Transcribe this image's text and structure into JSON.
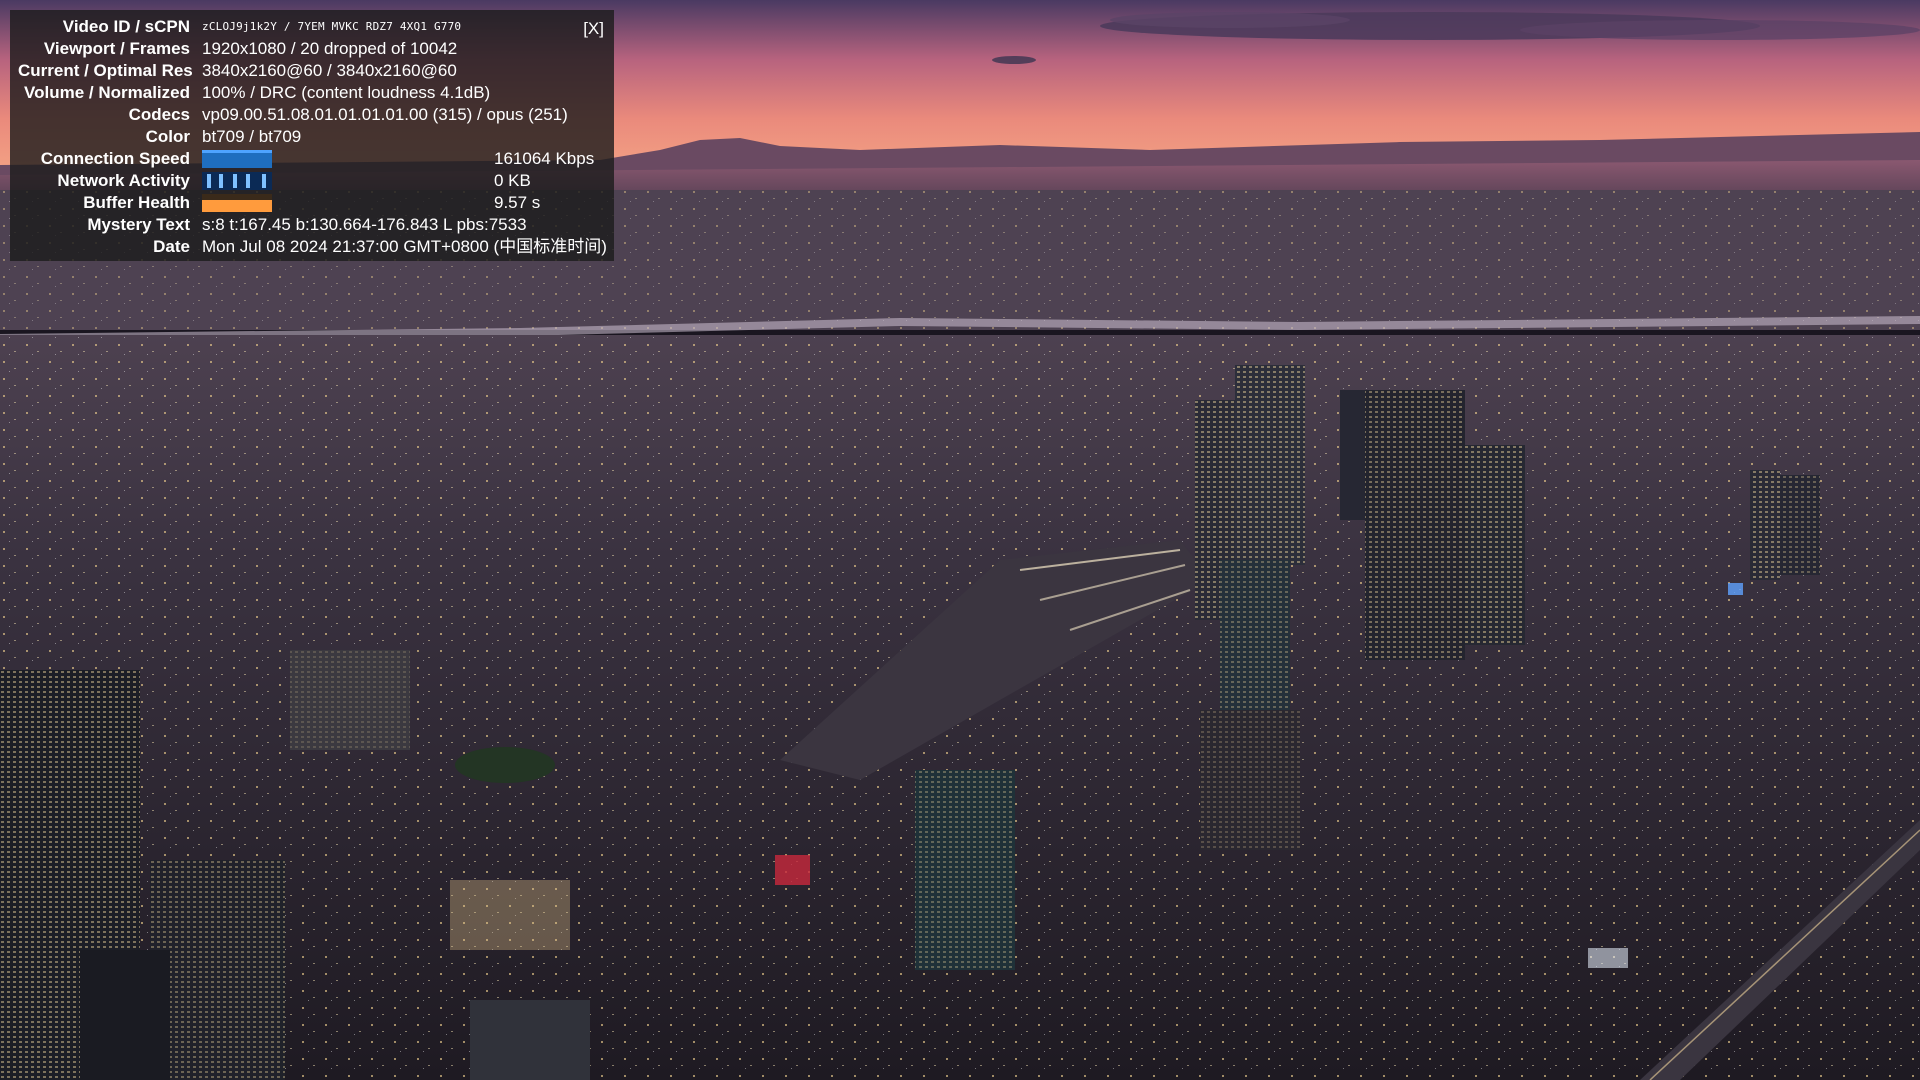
{
  "stats": {
    "close_label": "[X]",
    "rows": [
      {
        "label": "Video ID / sCPN",
        "value": "zCLOJ9j1k2Y / 7YEM MVKC RDZ7 4XQ1 G770"
      },
      {
        "label": "Viewport / Frames",
        "value": "1920x1080 / 20 dropped of 10042"
      },
      {
        "label": "Current / Optimal Res",
        "value": "3840x2160@60 / 3840x2160@60"
      },
      {
        "label": "Volume / Normalized",
        "value": "100% / DRC (content loudness 4.1dB)"
      },
      {
        "label": "Codecs",
        "value": "vp09.00.51.08.01.01.01.01.00 (315) / opus (251)"
      },
      {
        "label": "Color",
        "value": "bt709 / bt709"
      }
    ],
    "graphs": [
      {
        "label": "Connection Speed",
        "value": "161064 Kbps"
      },
      {
        "label": "Network Activity",
        "value": "0 KB"
      },
      {
        "label": "Buffer Health",
        "value": "9.57 s"
      }
    ],
    "tail_rows": [
      {
        "label": "Mystery Text",
        "value": "s:8 t:167.45 b:130.664-176.843 L pbs:7533"
      },
      {
        "label": "Date",
        "value": "Mon Jul 08 2024 21:37:00 GMT+0800 (中国标准时间)"
      }
    ]
  },
  "colors": {
    "sky_top": "#3b2f55",
    "sky_mid": "#d9707a",
    "sky_horizon": "#f29a7e",
    "city_base": "#2a2530",
    "overlay_bg": "#1c1c1c"
  },
  "icons": {
    "close": "close-icon"
  }
}
